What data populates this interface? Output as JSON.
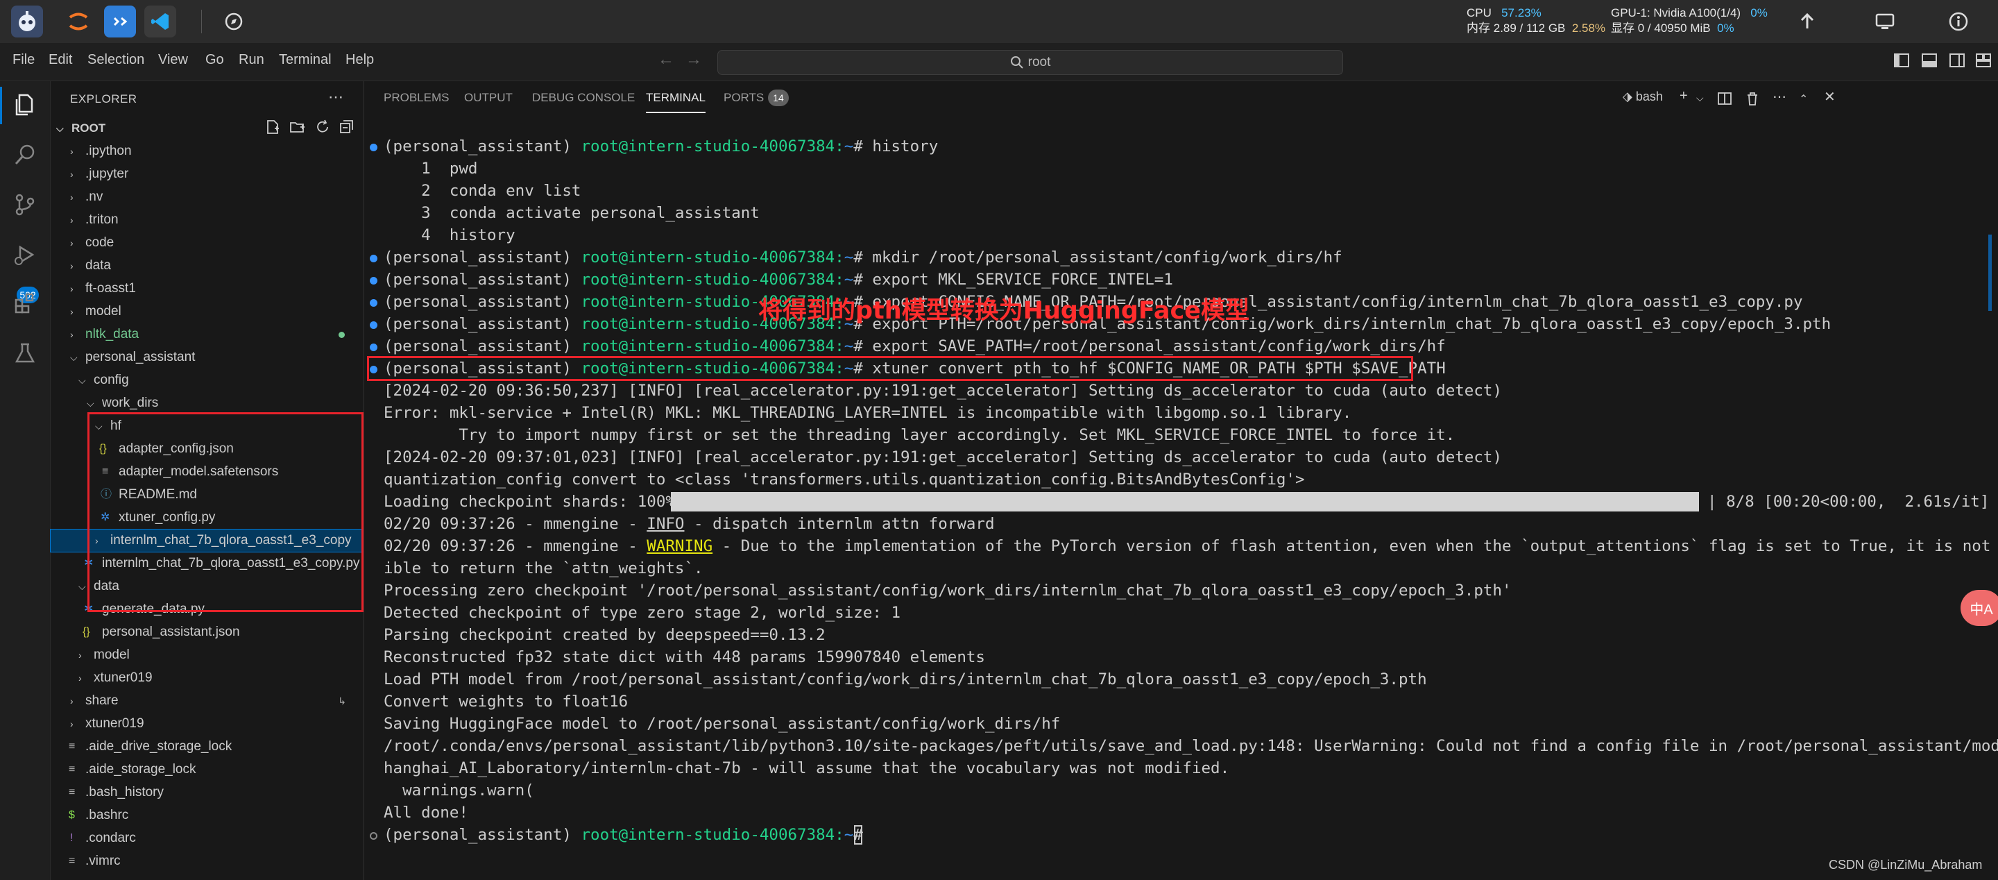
{
  "topbar": {
    "cpu_label": "CPU",
    "cpu_value": "57.23%",
    "mem_label": "内存",
    "mem_value": "2.89 / 112 GB",
    "mem_percent": "2.58%",
    "gpu_label": "GPU-1: Nvidia A100(1/4)",
    "gpu_value": "0%",
    "vram_label": "显存",
    "vram_value": "0 / 40950 MiB",
    "vram_percent": "0%"
  },
  "menu": {
    "items": [
      "File",
      "Edit",
      "Selection",
      "View",
      "Go",
      "Run",
      "Terminal",
      "Help"
    ],
    "search_text": "root"
  },
  "activity": {
    "scm_badge": "502"
  },
  "explorer": {
    "title": "EXPLORER",
    "root_label": "ROOT",
    "tree": [
      {
        "label": ".ipython",
        "kind": "folder"
      },
      {
        "label": ".jupyter",
        "kind": "folder"
      },
      {
        "label": ".nv",
        "kind": "folder"
      },
      {
        "label": ".triton",
        "kind": "folder"
      },
      {
        "label": "code",
        "kind": "folder"
      },
      {
        "label": "data",
        "kind": "folder"
      },
      {
        "label": "ft-oasst1",
        "kind": "folder"
      },
      {
        "label": "model",
        "kind": "folder"
      },
      {
        "label": "nltk_data",
        "kind": "folder"
      },
      {
        "label": "personal_assistant",
        "kind": "folder-open"
      },
      {
        "label": "config",
        "kind": "folder-open"
      },
      {
        "label": "work_dirs",
        "kind": "folder-open"
      },
      {
        "label": "hf",
        "kind": "folder-open"
      },
      {
        "label": "adapter_config.json",
        "kind": "json"
      },
      {
        "label": "adapter_model.safetensors",
        "kind": "file"
      },
      {
        "label": "README.md",
        "kind": "info"
      },
      {
        "label": "xtuner_config.py",
        "kind": "py"
      },
      {
        "label": "internlm_chat_7b_qlora_oasst1_e3_copy",
        "kind": "folder"
      },
      {
        "label": "internlm_chat_7b_qlora_oasst1_e3_copy.py",
        "kind": "py"
      },
      {
        "label": "data",
        "kind": "folder-open"
      },
      {
        "label": "generate_data.py",
        "kind": "py"
      },
      {
        "label": "personal_assistant.json",
        "kind": "json"
      },
      {
        "label": "model",
        "kind": "folder"
      },
      {
        "label": "xtuner019",
        "kind": "folder"
      },
      {
        "label": "share",
        "kind": "folder"
      },
      {
        "label": "xtuner019",
        "kind": "folder"
      },
      {
        "label": ".aide_drive_storage_lock",
        "kind": "file"
      },
      {
        "label": ".aide_storage_lock",
        "kind": "file"
      },
      {
        "label": ".bash_history",
        "kind": "file"
      },
      {
        "label": ".bashrc",
        "kind": "shell"
      },
      {
        "label": ".condarc",
        "kind": "bang"
      },
      {
        "label": ".vimrc",
        "kind": "file"
      }
    ]
  },
  "panel": {
    "tabs": [
      "PROBLEMS",
      "OUTPUT",
      "DEBUG CONSOLE",
      "TERMINAL",
      "PORTS"
    ],
    "ports_count": "14",
    "shell_name": "bash"
  },
  "terminal": {
    "prompt_env": "(personal_assistant)",
    "prompt_user": "root@intern-studio-40067384:",
    "prompt_path": "~",
    "prompt_suffix": "# ",
    "cmd_history": "history",
    "hist_1": "    1  pwd",
    "hist_2": "    2  conda env list",
    "hist_3": "    3  conda activate personal_assistant",
    "hist_4": "    4  history",
    "cmd_mkdir": "mkdir /root/personal_assistant/config/work_dirs/hf",
    "cmd_mkl": "export MKL_SERVICE_FORCE_INTEL=1",
    "cmd_config": "export CONFIG_NAME_OR_PATH=/root/personal_assistant/config/internlm_chat_7b_qlora_oasst1_e3_copy.py",
    "cmd_pth": "export PTH=/root/personal_assistant/config/work_dirs/internlm_chat_7b_qlora_oasst1_e3_copy/epoch_3.pth",
    "cmd_save": "export SAVE_PATH=/root/personal_assistant/config/work_dirs/hf",
    "cmd_convert": "xtuner convert pth_to_hf $CONFIG_NAME_OR_PATH $PTH $SAVE_PATH",
    "out_1": "[2024-02-20 09:36:50,237] [INFO] [real_accelerator.py:191:get_accelerator] Setting ds_accelerator to cuda (auto detect)",
    "out_2": "Error: mkl-service + Intel(R) MKL: MKL_THREADING_LAYER=INTEL is incompatible with libgomp.so.1 library.",
    "out_3": "        Try to import numpy first or set the threading layer accordingly. Set MKL_SERVICE_FORCE_INTEL to force it.",
    "out_4": "[2024-02-20 09:37:01,023] [INFO] [real_accelerator.py:191:get_accelerator] Setting ds_accelerator to cuda (auto detect)",
    "out_5": "quantization_config convert to <class 'transformers.utils.quantization_config.BitsAndBytesConfig'>",
    "out_6_prefix": "Loading checkpoint shards: 100%|",
    "out_6_suffix": "| 8/8 [00:20<00:00,  2.61s/it]",
    "progress": 1.0,
    "out_7_prefix": "02/20 09:37:26 - mmengine - ",
    "out_7_level": "INFO",
    "out_7_msg": " - dispatch internlm attn forward",
    "out_8_prefix": "02/20 09:37:26 - mmengine - ",
    "out_8_level": "WARNING",
    "out_8_msg": " - Due to the implementation of the PyTorch version of flash attention, even when the `output_attentions` flag is set to True, it is not poss",
    "out_9": "ible to return the `attn_weights`.",
    "out_10": "Processing zero checkpoint '/root/personal_assistant/config/work_dirs/internlm_chat_7b_qlora_oasst1_e3_copy/epoch_3.pth'",
    "out_11": "Detected checkpoint of type zero stage 2, world_size: 1",
    "out_12": "Parsing checkpoint created by deepspeed==0.13.2",
    "out_13": "Reconstructed fp32 state dict with 448 params 159907840 elements",
    "out_14": "Load PTH model from /root/personal_assistant/config/work_dirs/internlm_chat_7b_qlora_oasst1_e3_copy/epoch_3.pth",
    "out_15": "Convert weights to float16",
    "out_16": "Saving HuggingFace model to /root/personal_assistant/config/work_dirs/hf",
    "out_17": "/root/.conda/envs/personal_assistant/lib/python3.10/site-packages/peft/utils/save_and_load.py:148: UserWarning: Could not find a config file in /root/personal_assistant/model/S",
    "out_18": "hanghai_AI_Laboratory/internlm-chat-7b - will assume that the vocabulary was not modified.",
    "out_19": "  warnings.warn(",
    "out_20": "All done!"
  },
  "annotation": "将得到的pth模型转换为HuggingFace模型",
  "watermark": "CSDN @LinZiMu_Abraham",
  "fab_label": "中A",
  "colors": {
    "accent": "#0078d4",
    "annotation_red": "#e8232b",
    "prompt_green": "#23d18b",
    "path_blue": "#3b8eea"
  }
}
